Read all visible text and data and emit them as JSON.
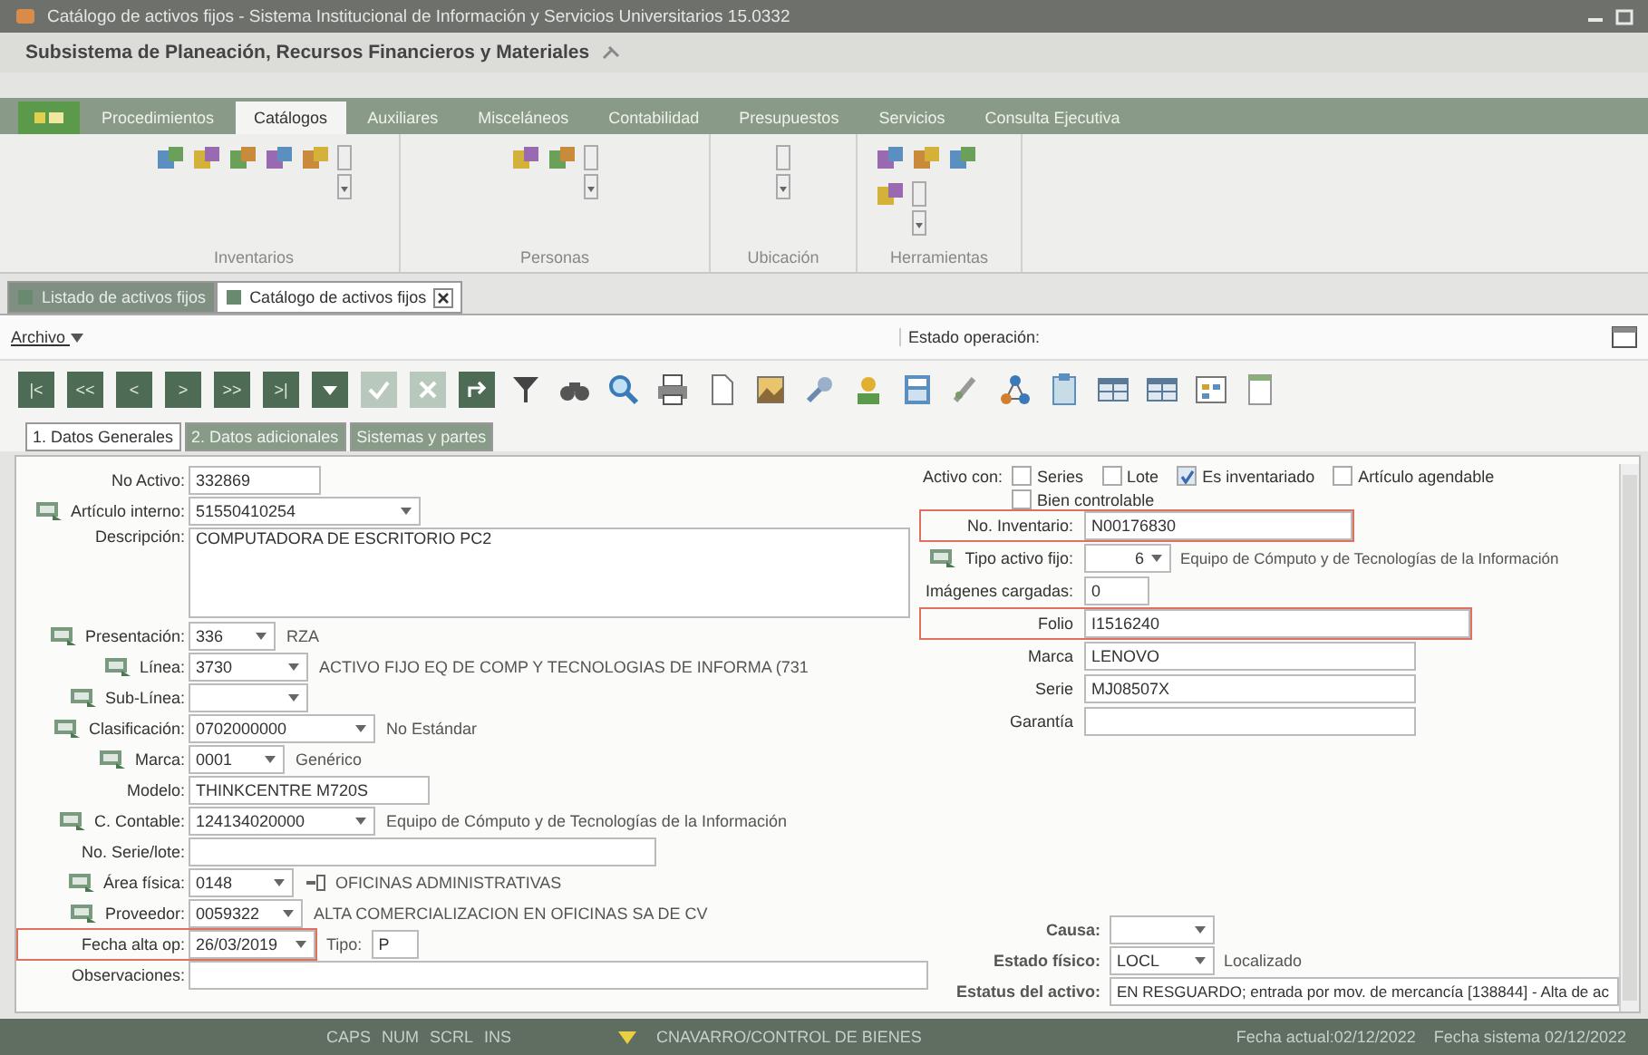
{
  "window": {
    "title": "Catálogo de activos fijos - Sistema Institucional de Información y Servicios Universitarios 15.0332"
  },
  "subsystem": "Subsistema de Planeación, Recursos Financieros y Materiales",
  "ribbon_tabs": [
    {
      "label": "Procedimientos",
      "selected": false
    },
    {
      "label": "Catálogos",
      "selected": true
    },
    {
      "label": "Auxiliares",
      "selected": false
    },
    {
      "label": "Misceláneos",
      "selected": false
    },
    {
      "label": "Contabilidad",
      "selected": false
    },
    {
      "label": "Presupuestos",
      "selected": false
    },
    {
      "label": "Servicios",
      "selected": false
    },
    {
      "label": "Consulta Ejecutiva",
      "selected": false
    }
  ],
  "ribbon_groups": [
    {
      "label": "Inventarios"
    },
    {
      "label": "Personas"
    },
    {
      "label": "Ubicación"
    },
    {
      "label": "Herramientas"
    }
  ],
  "document_tabs": [
    {
      "label": "Listado de activos fijos",
      "selected": false
    },
    {
      "label": "Catálogo de activos fijos",
      "selected": true
    }
  ],
  "menu": {
    "label": "Archivo",
    "operation_status": "Estado operación:"
  },
  "navigation_buttons": [
    "|<",
    "<<",
    "<",
    ">",
    ">>",
    ">|"
  ],
  "form_tabs": [
    {
      "label": "1. Datos Generales",
      "selected": true
    },
    {
      "label": "2. Datos adicionales",
      "selected": false
    },
    {
      "label": "Sistemas y partes",
      "selected": false
    }
  ],
  "left_fields": [
    {
      "kind": "field",
      "label": "No Activo:",
      "icon": false,
      "value": "332869",
      "dropdown": false,
      "locator": false,
      "highlighted": false
    },
    {
      "kind": "field",
      "label": "Artículo interno:",
      "icon": true,
      "value": "51550410254",
      "dropdown": true,
      "locator": false,
      "highlighted": false
    },
    {
      "kind": "textarea",
      "label": "Descripción:",
      "icon": false,
      "value": "COMPUTADORA DE ESCRITORIO PC2",
      "dropdown": false,
      "locator": false,
      "highlighted": false
    },
    {
      "kind": "field",
      "label": "Presentación:",
      "icon": true,
      "value": "336",
      "dropdown": true,
      "locator": false,
      "highlighted": false,
      "description": "RZA"
    },
    {
      "kind": "field",
      "label": "Línea:",
      "icon": true,
      "value": "3730",
      "dropdown": true,
      "locator": false,
      "highlighted": false,
      "description": "ACTIVO FIJO EQ DE COMP Y TECNOLOGIAS DE INFORMA (731"
    },
    {
      "kind": "field",
      "label": "Sub-Línea:",
      "icon": true,
      "dropdown": true,
      "locator": false,
      "highlighted": false
    },
    {
      "kind": "field",
      "label": "Clasificación:",
      "icon": true,
      "value": "0702000000",
      "dropdown": true,
      "locator": false,
      "highlighted": false,
      "description": "No Estándar"
    },
    {
      "kind": "field",
      "label": "Marca:",
      "icon": true,
      "value": "0001",
      "dropdown": true,
      "locator": false,
      "highlighted": false,
      "description": "Genérico"
    },
    {
      "kind": "field",
      "label": "Modelo:",
      "icon": false,
      "value": "THINKCENTRE M720S",
      "dropdown": false,
      "locator": false,
      "highlighted": false
    },
    {
      "kind": "field",
      "label": "C. Contable:",
      "icon": true,
      "value": "124134020000",
      "dropdown": true,
      "locator": false,
      "highlighted": false,
      "description": "Equipo de Cómputo y de Tecnologías de la Información"
    },
    {
      "kind": "field",
      "label": "No. Serie/lote:",
      "icon": false,
      "dropdown": false,
      "locator": false,
      "highlighted": false
    },
    {
      "kind": "field",
      "label": "Área física:",
      "icon": true,
      "value": "0148",
      "dropdown": true,
      "locator": true,
      "highlighted": false,
      "description": "OFICINAS ADMINISTRATIVAS"
    },
    {
      "kind": "field",
      "label": "Proveedor:",
      "icon": true,
      "value": "0059322",
      "dropdown": true,
      "locator": false,
      "highlighted": false,
      "description": "ALTA COMERCIALIZACION EN OFICINAS SA DE CV"
    },
    {
      "kind": "field",
      "label": "Fecha alta op:",
      "icon": false,
      "value": "26/03/2019",
      "dropdown": true,
      "locator": false,
      "highlighted": true,
      "extra_label": "Tipo:",
      "extra_value": "P"
    },
    {
      "kind": "field",
      "label": "Observaciones:",
      "icon": false,
      "dropdown": false,
      "locator": false,
      "highlighted": false
    }
  ],
  "active_with": {
    "label": "Activo con:",
    "options": [
      {
        "label": "Series",
        "checked": false
      },
      {
        "label": "Lote",
        "checked": false
      },
      {
        "label": "Es inventariado",
        "checked": true
      },
      {
        "label": "Artículo agendable",
        "checked": false
      },
      {
        "label": "Bien controlable",
        "checked": false
      }
    ]
  },
  "right_fields": [
    {
      "label": "No. Inventario:",
      "icon": false,
      "value": "N00176830",
      "dropdown": false,
      "highlighted": true
    },
    {
      "label": "Tipo activo fijo:",
      "icon": true,
      "value": "6",
      "dropdown": true,
      "highlighted": false,
      "description": "Equipo de Cómputo y de Tecnologías de la Información"
    },
    {
      "label": "Imágenes cargadas:",
      "icon": false,
      "value": "0",
      "dropdown": false,
      "highlighted": false
    },
    {
      "label": "Folio",
      "icon": false,
      "value": "I1516240",
      "dropdown": false,
      "highlighted": true
    },
    {
      "label": "Marca",
      "icon": false,
      "value": "LENOVO",
      "dropdown": false,
      "highlighted": false
    },
    {
      "label": "Serie",
      "icon": false,
      "value": "MJ08507X",
      "dropdown": false,
      "highlighted": false
    },
    {
      "label": "Garantía",
      "icon": false,
      "dropdown": false,
      "highlighted": false
    }
  ],
  "bottom_fields": [
    {
      "label": "Causa:",
      "dropdown": true
    },
    {
      "label": "Estado físico:",
      "value": "LOCL",
      "dropdown": true,
      "description": "Localizado"
    },
    {
      "label": "Estatus del activo:",
      "value": "EN RESGUARDO;  entrada por mov. de mercancía [138844] - Alta de ac",
      "dropdown": false
    }
  ],
  "status_bar": {
    "keys": [
      "CAPS",
      "NUM",
      "SCRL",
      "INS"
    ],
    "user": "CNAVARRO/CONTROL DE BIENES",
    "current_date": "Fecha actual:02/12/2022",
    "system_date": "Fecha sistema 02/12/2022"
  }
}
